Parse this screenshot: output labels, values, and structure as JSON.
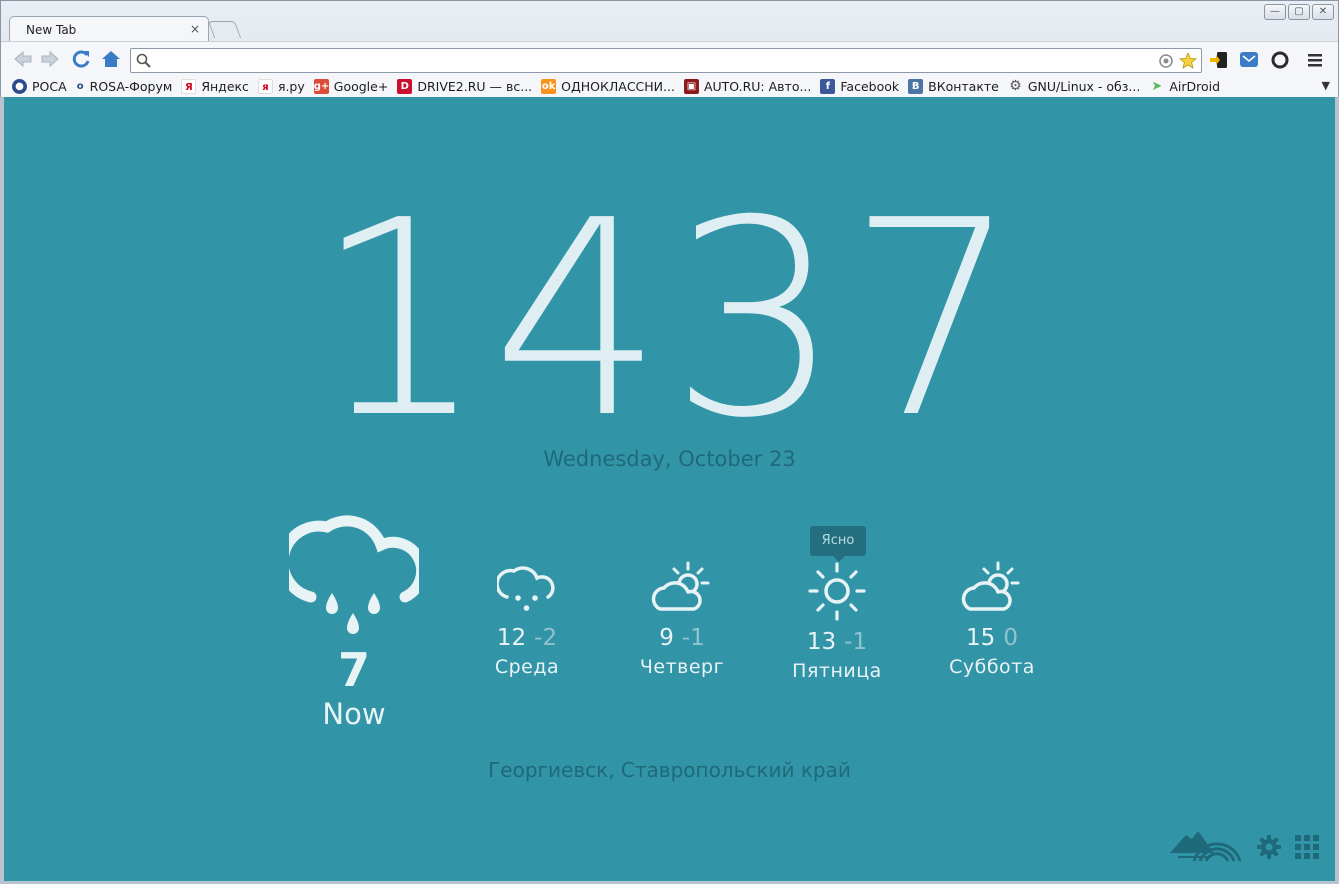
{
  "browser": {
    "tab_title": "New Tab",
    "tab_close": "×",
    "window_buttons": [
      "—",
      "▢",
      "✕"
    ],
    "address_value": "",
    "bookmarks": [
      {
        "label": "РОСА",
        "icon": "rosa-icon",
        "color": "#2b4c8c"
      },
      {
        "label": "ROSA-Форум",
        "icon": "rosa-forum-icon",
        "color": "#ffffff"
      },
      {
        "label": "Яндекс",
        "icon": "yandex-icon",
        "color": "#ffffff"
      },
      {
        "label": "я.ру",
        "icon": "yaru-icon",
        "color": "#ffffff"
      },
      {
        "label": "Google+",
        "icon": "google-plus-icon",
        "color": "#dd4b39"
      },
      {
        "label": "DRIVE2.RU — вс...",
        "icon": "drive2-icon",
        "color": "#c8102e"
      },
      {
        "label": "ОДНОКЛАССНИ...",
        "icon": "odnoklassniki-icon",
        "color": "#f7931e"
      },
      {
        "label": "AUTO.RU: Авто...",
        "icon": "autoru-icon",
        "color": "#8b1a1a"
      },
      {
        "label": "Facebook",
        "icon": "facebook-icon",
        "color": "#3b5998"
      },
      {
        "label": "ВКонтакте",
        "icon": "vkontakte-icon",
        "color": "#4c75a3"
      },
      {
        "label": "GNU/Linux - обз...",
        "icon": "gear-icon",
        "color": "#666666"
      },
      {
        "label": "AirDroid",
        "icon": "airdroid-icon",
        "color": "#5cb85c"
      }
    ],
    "bookmarks_more": "▼"
  },
  "clock": {
    "time": "1437"
  },
  "date": {
    "text": "Wednesday, October 23"
  },
  "weather": {
    "now": {
      "temp": "7",
      "label": "Now",
      "icon": "rain-cloud-icon"
    },
    "forecast": [
      {
        "hi": "12",
        "lo": "-2",
        "day": "Среда",
        "icon": "rain-cloud-icon"
      },
      {
        "hi": "9",
        "lo": "-1",
        "day": "Четверг",
        "icon": "partly-cloudy-icon"
      },
      {
        "hi": "13",
        "lo": "-1",
        "day": "Пятница",
        "icon": "sun-icon"
      },
      {
        "hi": "15",
        "lo": "0",
        "day": "Суббота",
        "icon": "partly-cloudy-icon"
      }
    ],
    "tooltip": "Ясно",
    "location": "Георгиевск, Ставропольский край"
  },
  "colors": {
    "background": "#3194a7",
    "text_light": "#e8f3f6",
    "text_dark": "#1f6a7a",
    "low_temp": "#8fc4cf"
  }
}
